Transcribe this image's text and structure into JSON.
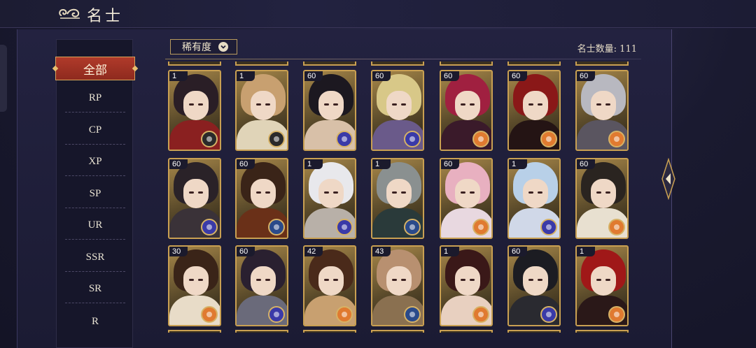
{
  "header": {
    "title": "名士",
    "icon": "cloud-swirl-icon"
  },
  "sidebar": {
    "items": [
      {
        "label": "全部",
        "active": true
      },
      {
        "label": "RP"
      },
      {
        "label": "CP"
      },
      {
        "label": "XP"
      },
      {
        "label": "SP"
      },
      {
        "label": "UR"
      },
      {
        "label": "SSR"
      },
      {
        "label": "SR"
      },
      {
        "label": "R"
      }
    ]
  },
  "toolbar": {
    "filter_label": "稀有度",
    "filter_icon": "chevron-down-icon",
    "count_text": "名士数量: 111"
  },
  "colors": {
    "accent_red": "#a8301f",
    "gold": "#c9a052",
    "bg": "#1b1b33"
  },
  "cards": [
    {
      "level": "1",
      "hair": "#2a1e26",
      "robe": "#8a2020",
      "badge": "#2a2a2a"
    },
    {
      "level": "1",
      "hair": "#c8a070",
      "robe": "#e0d4b8",
      "badge": "#2a2a2a"
    },
    {
      "level": "60",
      "hair": "#1c1820",
      "robe": "#d8c0a8",
      "badge": "#3a3aa8"
    },
    {
      "level": "60",
      "hair": "#d8c888",
      "robe": "#6a5a8a",
      "badge": "#3a3aa8"
    },
    {
      "level": "60",
      "hair": "#a02040",
      "robe": "#3a1a2a",
      "badge": "#e07a30"
    },
    {
      "level": "60",
      "hair": "#8a1818",
      "robe": "#241414",
      "badge": "#e07a30"
    },
    {
      "level": "60",
      "hair": "#b8b8c0",
      "robe": "#5a5560",
      "badge": "#e07a30"
    },
    {
      "level": "60",
      "hair": "#2a2228",
      "robe": "#3a3238",
      "badge": "#3a3aa8"
    },
    {
      "level": "60",
      "hair": "#3a2418",
      "robe": "#6a3018",
      "badge": "#2a4a8a"
    },
    {
      "level": "1",
      "hair": "#e8e8ec",
      "robe": "#b8b0a8",
      "badge": "#3a3aa8"
    },
    {
      "level": "1",
      "hair": "#8a9090",
      "robe": "#2a3a3a",
      "badge": "#2a4a8a"
    },
    {
      "level": "60",
      "hair": "#e8b0c0",
      "robe": "#e8d8e0",
      "badge": "#e07a30"
    },
    {
      "level": "1",
      "hair": "#b8d0e8",
      "robe": "#d0d8e8",
      "badge": "#3a3aa8"
    },
    {
      "level": "60",
      "hair": "#2a2420",
      "robe": "#e8e0d0",
      "badge": "#e07a30"
    },
    {
      "level": "30",
      "hair": "#3a2418",
      "robe": "#e8dcc8",
      "badge": "#e07a30"
    },
    {
      "level": "60",
      "hair": "#2a2030",
      "robe": "#6a6a7a",
      "badge": "#3a3aa8"
    },
    {
      "level": "42",
      "hair": "#4a2a1a",
      "robe": "#c8a070",
      "badge": "#e07a30"
    },
    {
      "level": "43",
      "hair": "#b89070",
      "robe": "#8a7050",
      "badge": "#2a4a8a"
    },
    {
      "level": "1",
      "hair": "#3a1818",
      "robe": "#e8d0c0",
      "badge": "#e07a30"
    },
    {
      "level": "60",
      "hair": "#1c1c22",
      "robe": "#2a2a30",
      "badge": "#3a3aa8"
    },
    {
      "level": "1",
      "hair": "#a01818",
      "robe": "#2a1818",
      "badge": "#e07a30"
    }
  ]
}
